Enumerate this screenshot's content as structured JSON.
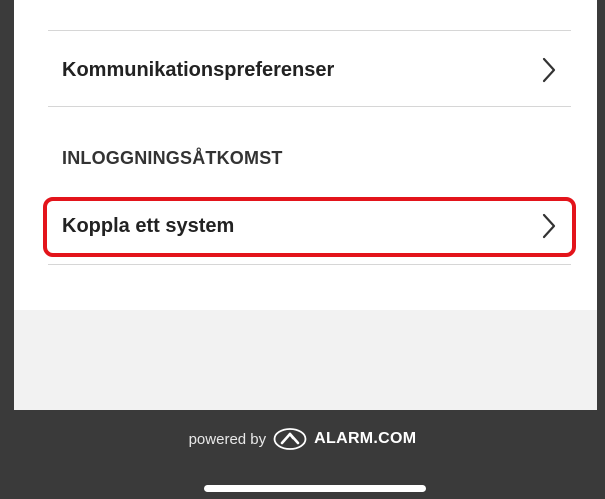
{
  "settings": {
    "items": [
      {
        "label": "Kommunikationspreferenser"
      }
    ],
    "section_header": "INLOGGNINGSÅTKOMST",
    "login_items": [
      {
        "label": "Koppla ett system"
      }
    ]
  },
  "footer": {
    "powered_by": "powered by",
    "brand": "ALARM.COM"
  },
  "colors": {
    "highlight": "#e3141b",
    "footer_bg": "#3a3a3a",
    "gray_bg": "#f2f2f2"
  },
  "icons": {
    "row_chevron": "chevron-right-icon",
    "brand_logo": "alarm-com-logo-icon"
  }
}
